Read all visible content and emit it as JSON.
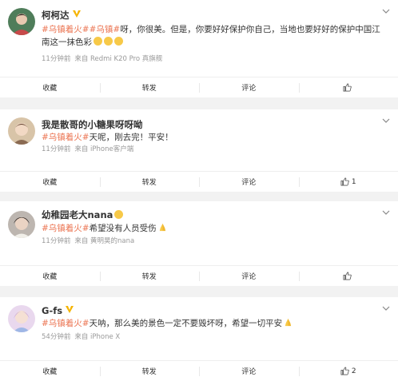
{
  "posts": [
    {
      "user": "柯柯达",
      "verified": true,
      "tags": [
        "#乌镇着火#",
        "#乌镇#"
      ],
      "text": "呀，你很美。但是，你要好好保护你自己，当地也要好好的保护中国江南这一抹色彩",
      "time": "11分钟前",
      "source": "来自 Redmi K20 Pro 真旗舰",
      "actions": {
        "collect": "收藏",
        "forward": "转发",
        "comment": "评论",
        "like": ""
      }
    },
    {
      "user": "我是散哥的小糖果呀呀呦",
      "verified": false,
      "tags": [
        "#乌镇着火#"
      ],
      "text": "天呢，刚去完！平安！",
      "time": "11分钟前",
      "source": "来自 iPhone客户端",
      "actions": {
        "collect": "收藏",
        "forward": "转发",
        "comment": "评论",
        "like": "1"
      }
    },
    {
      "user": "幼稚园老大nana",
      "verified": false,
      "tags": [
        "#乌镇着火#"
      ],
      "text": "希望没有人员受伤",
      "time": "11分钟前",
      "source": "来自 黄明昊的nana",
      "actions": {
        "collect": "收藏",
        "forward": "转发",
        "comment": "评论",
        "like": ""
      }
    },
    {
      "user": "G-fs",
      "verified": true,
      "tags": [
        "#乌镇着火#"
      ],
      "text": "天呐，那么美的景色一定不要毁坏呀，希望一切平安",
      "time": "54分钟前",
      "source": "来自 iPhone X",
      "actions": {
        "collect": "收藏",
        "forward": "转发",
        "comment": "评论",
        "like": "2"
      }
    }
  ],
  "colors": {
    "tag": "#eb7350",
    "verified": "#f5b400",
    "meta": "#999999"
  }
}
